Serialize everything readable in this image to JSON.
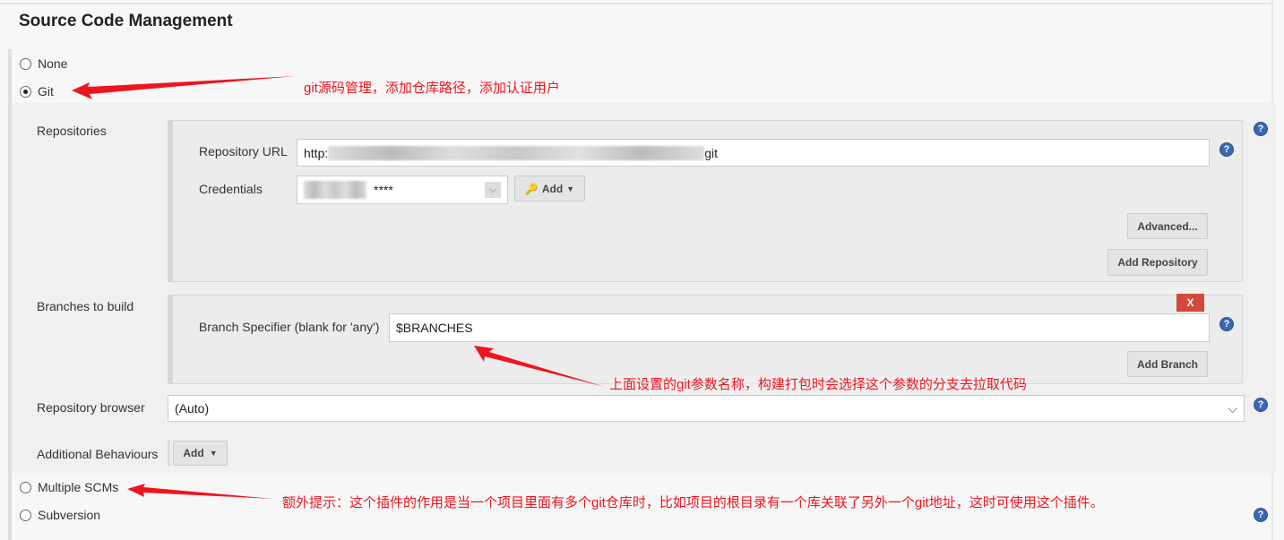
{
  "section_title": "Source Code Management",
  "scm_options": [
    {
      "label": "None",
      "selected": false
    },
    {
      "label": "Git",
      "selected": true
    },
    {
      "label": "Multiple SCMs",
      "selected": false
    },
    {
      "label": "Subversion",
      "selected": false
    }
  ],
  "repositories": {
    "label": "Repositories",
    "url_label": "Repository URL",
    "url_prefix": "http:",
    "url_suffix": "git",
    "credentials_label": "Credentials",
    "credentials_value": "****",
    "add_label": "Add",
    "advanced_label": "Advanced...",
    "add_repository_label": "Add Repository"
  },
  "branches": {
    "label": "Branches to build",
    "delete_label": "X",
    "specifier_label": "Branch Specifier (blank for 'any')",
    "specifier_value": "$BRANCHES",
    "add_branch_label": "Add Branch"
  },
  "repository_browser": {
    "label": "Repository browser",
    "value": "(Auto)"
  },
  "additional_behaviours": {
    "label": "Additional Behaviours",
    "add_label": "Add"
  },
  "help_glyph": "?",
  "annotations": {
    "git_note": "git源码管理，添加仓库路径，添加认证用户",
    "branch_note": "上面设置的git参数名称，构建打包时会选择这个参数的分支去拉取代码",
    "multi_scm_note": "额外提示：这个插件的作用是当一个项目里面有多个git仓库时，比如项目的根目录有一个库关联了另外一个git地址，这时可使用这个插件。"
  },
  "colors": {
    "annotation": "#f0141e",
    "help": "#3a67b5",
    "delete": "#d24939"
  }
}
